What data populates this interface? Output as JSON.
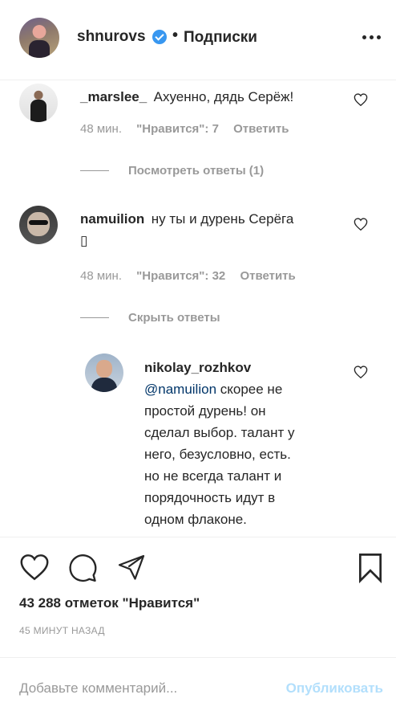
{
  "header": {
    "username": "shnurovs",
    "separator": "•",
    "follow_label": "Подписки"
  },
  "comments": [
    {
      "username": "_marslee_",
      "text": "Ахуенно, дядь Серёж!",
      "time": "48 мин.",
      "likes": "\"Нравится\": 7",
      "reply": "Ответить",
      "thread": "Посмотреть ответы (1)"
    },
    {
      "username": "namuilion",
      "text": "ну ты и дурень Серёга",
      "text_line2": "▯",
      "time": "48 мин.",
      "likes": "\"Нравится\": 32",
      "reply": "Ответить",
      "thread": "Скрыть ответы"
    }
  ],
  "reply": {
    "username": "nikolay_rozhkov",
    "mention": "@namuilion",
    "lines": [
      " скорее не",
      "простой дурень! он",
      "сделал выбор. талант у",
      "него, безусловно, есть.",
      "но не всегда талант и",
      "порядочность идут в",
      "одном флаконе."
    ]
  },
  "post": {
    "likes_count": "43 288 отметок \"Нравится\"",
    "time_ago": "45 МИНУТ НАЗАД"
  },
  "add_comment": {
    "placeholder": "Добавьте комментарий...",
    "publish_label": "Опубликовать"
  },
  "colors": {
    "text": "#262626",
    "secondary": "#999999",
    "verified": "#3897f0",
    "mention": "#003569",
    "publish_disabled": "#b2dffc"
  },
  "icons": [
    "more-icon",
    "heart-icon",
    "comment-icon",
    "share-icon",
    "bookmark-icon",
    "verified-icon"
  ]
}
